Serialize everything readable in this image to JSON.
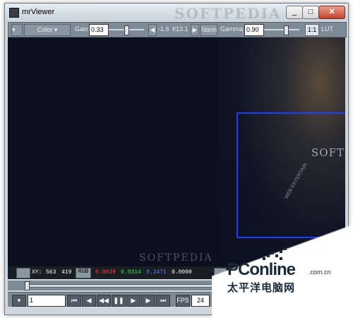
{
  "window": {
    "title": "mrViewer",
    "watermark": "SOFTPEDIA"
  },
  "titlebar_buttons": {
    "minimize": "_",
    "maximize": "□",
    "close": "✕"
  },
  "toolbar": {
    "channel": "Color",
    "gain_label": "Gain",
    "gain_value": "0.33",
    "fstop_value": "-1.6",
    "fnumber_value": "f/13.1",
    "norm_label": "Norm",
    "gamma_label": "Gamma",
    "gamma_value": "0.90",
    "ratio_label": "1:1",
    "lut_label": "LUT"
  },
  "viewer": {
    "overlay_text": "SOFT",
    "side_text": "WEB ENTERTAIN",
    "bottom_watermark": "SOFTPEDIA",
    "bottom_url": "www.softpedia.com"
  },
  "infobar": {
    "xy_label": "XY:",
    "x_value": "563",
    "y_value": "419",
    "mode_label": "RGB",
    "r_value": "0.0039",
    "g_value": "0.0314",
    "b_value": "0.2471",
    "a_value": "0.0000"
  },
  "controls": {
    "frame_value": "1",
    "fps_label": "FPS",
    "fps_value": "24"
  },
  "branding": {
    "logo": "PConline",
    "domain": ".com.cn",
    "subtitle": "太平洋电脑网"
  },
  "colors": {
    "selection_rect": "#1f3cff",
    "r_text": "#ff4040",
    "g_text": "#40e060",
    "b_text": "#5080ff",
    "a_text": "#ffffff"
  }
}
